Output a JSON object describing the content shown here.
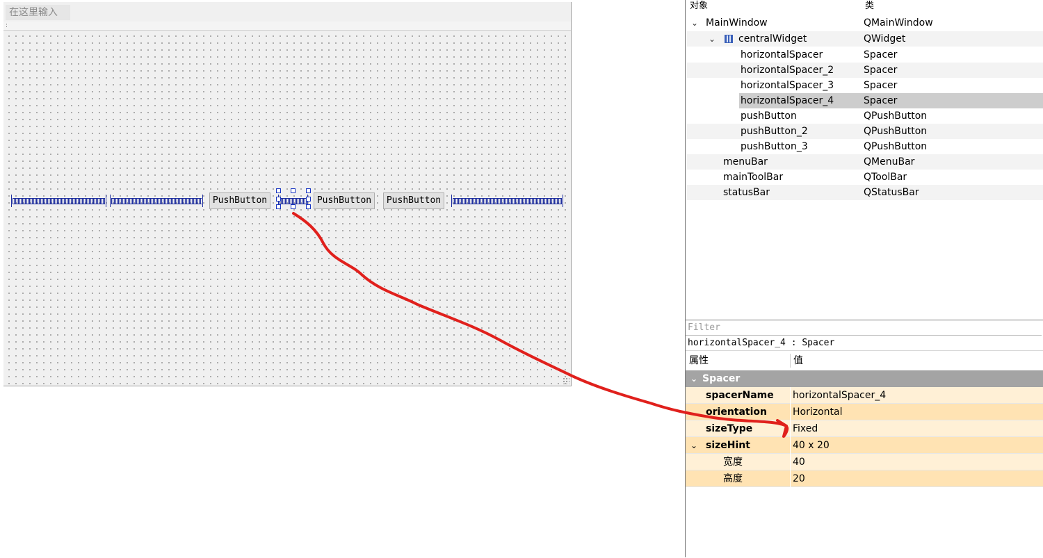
{
  "form": {
    "menu_placeholder": "在这里输入",
    "toolbar_handle": ":",
    "buttons": [
      "PushButton",
      "PushButton",
      "PushButton"
    ]
  },
  "object_inspector": {
    "header_object": "对象",
    "header_class": "类",
    "rows": [
      {
        "name": "MainWindow",
        "class": "QMainWindow"
      },
      {
        "name": "centralWidget",
        "class": "QWidget"
      },
      {
        "name": "horizontalSpacer",
        "class": "Spacer"
      },
      {
        "name": "horizontalSpacer_2",
        "class": "Spacer"
      },
      {
        "name": "horizontalSpacer_3",
        "class": "Spacer"
      },
      {
        "name": "horizontalSpacer_4",
        "class": "Spacer"
      },
      {
        "name": "pushButton",
        "class": "QPushButton"
      },
      {
        "name": "pushButton_2",
        "class": "QPushButton"
      },
      {
        "name": "pushButton_3",
        "class": "QPushButton"
      },
      {
        "name": "menuBar",
        "class": "QMenuBar"
      },
      {
        "name": "mainToolBar",
        "class": "QToolBar"
      },
      {
        "name": "statusBar",
        "class": "QStatusBar"
      }
    ],
    "selected": "horizontalSpacer_4"
  },
  "property_editor": {
    "filter_placeholder": "Filter",
    "object_caption": "horizontalSpacer_4 : Spacer",
    "header_property": "属性",
    "header_value": "值",
    "group": "Spacer",
    "properties": [
      {
        "name": "spacerName",
        "value": "horizontalSpacer_4"
      },
      {
        "name": "orientation",
        "value": "Horizontal"
      },
      {
        "name": "sizeType",
        "value": "Fixed"
      },
      {
        "name": "sizeHint",
        "value": "40 x 20"
      },
      {
        "name": "宽度",
        "value": "40"
      },
      {
        "name": "高度",
        "value": "20"
      }
    ]
  },
  "colors": {
    "annotation": "#e0201c",
    "spacer": "#1f2f9f",
    "selection": "#cdcdcd",
    "group_header": "#a4a4a4",
    "prop_light": "#fff0d6",
    "prop_dark": "#ffe3b3"
  }
}
